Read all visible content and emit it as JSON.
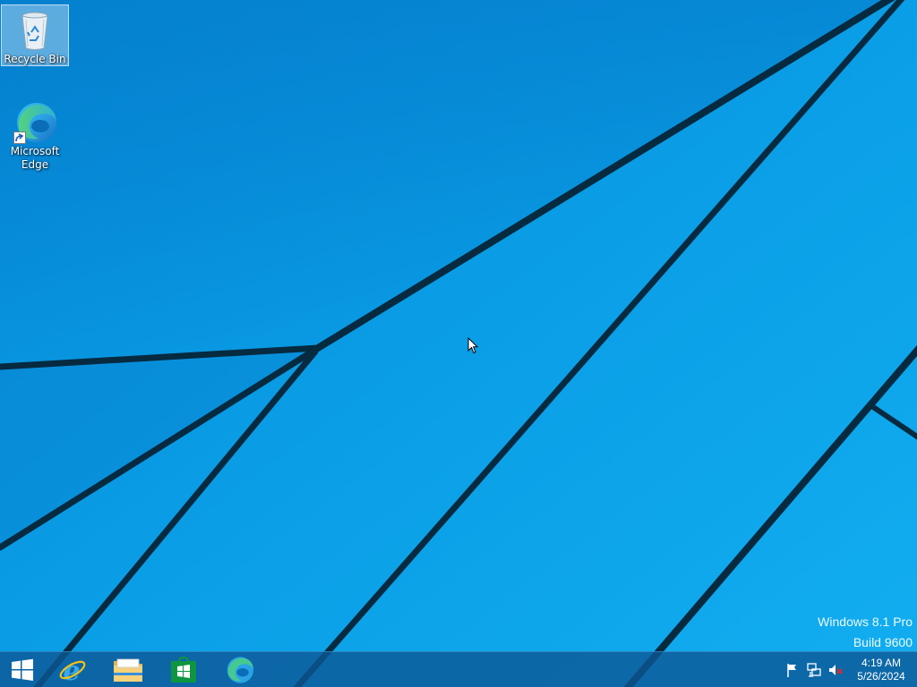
{
  "desktop": {
    "background_color": "#0a97e0",
    "line_color": "#062a3f",
    "icons": [
      {
        "label": "Recycle Bin",
        "icon": "recycle-bin-icon",
        "selected": true
      },
      {
        "label_line1": "Microsoft",
        "label_line2": "Edge",
        "icon": "edge-icon"
      }
    ]
  },
  "watermark": {
    "line1": "Windows 8.1 Pro",
    "line2": "Build 9600"
  },
  "taskbar": {
    "color": "#0c5896",
    "pinned": [
      {
        "icon": "start-windows-icon"
      },
      {
        "icon": "internet-explorer-icon"
      },
      {
        "icon": "file-explorer-icon"
      },
      {
        "icon": "store-icon"
      },
      {
        "icon": "edge-icon"
      }
    ],
    "tray": {
      "icons": [
        "action-center-flag-icon",
        "network-icon",
        "volume-muted-icon"
      ],
      "time": "4:19 AM",
      "date": "5/26/2024"
    }
  }
}
